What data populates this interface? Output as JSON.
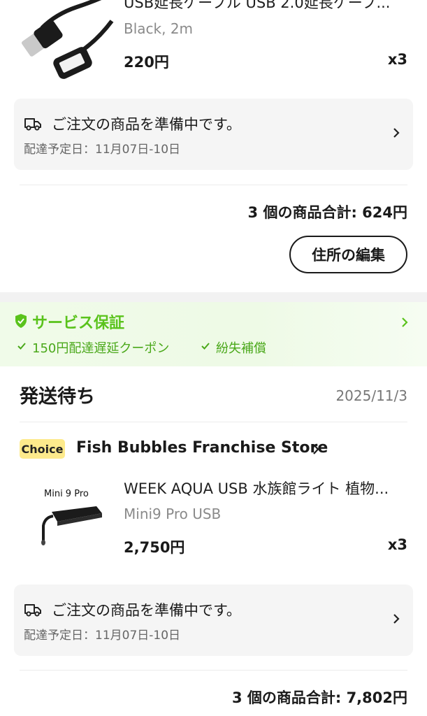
{
  "order1": {
    "product": {
      "title": "USB延長ケーブル USB 2.0延長ケーブ...",
      "variant": "Black, 2m",
      "price": "220円",
      "qty": "x3",
      "image_icon": "usb-extension-cable-icon"
    },
    "status": {
      "text": "ご注文の商品を準備中です。",
      "delivery": "配達予定日：11月07日-10日",
      "icon": "truck-icon"
    },
    "total": "3 個の商品合計: 624円",
    "edit_address_label": "住所の編集"
  },
  "service": {
    "title": "サービス保証",
    "items": [
      "150円配達遅延クーポン",
      "紛失補償"
    ],
    "accent_color": "#5ac31c"
  },
  "order2": {
    "status_title": "発送待ち",
    "date": "2025/11/3",
    "badge": "Choice",
    "store": "Fish Bubbles Franchise Store",
    "product": {
      "image_label": "Mini 9 Pro",
      "title": "WEEK AQUA USB 水族館ライト 植物...",
      "variant": "Mini9 Pro USB",
      "price": "2,750円",
      "qty": "x3",
      "image_icon": "aquarium-light-icon"
    },
    "status": {
      "text": "ご注文の商品を準備中です。",
      "delivery": "配達予定日：11月07日-10日",
      "icon": "truck-icon"
    },
    "total": "3 個の商品合計: 7,802円"
  }
}
